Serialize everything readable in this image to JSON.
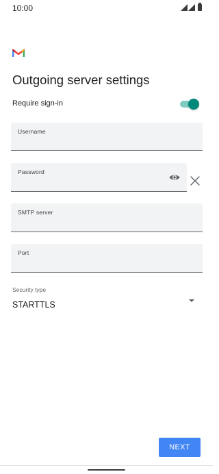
{
  "status_bar": {
    "time": "10:00"
  },
  "app": {
    "logo_icon": "gmail-logo-icon"
  },
  "page": {
    "title": "Outgoing server settings"
  },
  "require_sign_in": {
    "label": "Require sign-in",
    "enabled": true
  },
  "fields": {
    "username": {
      "label": "Username",
      "value": ""
    },
    "password": {
      "label": "Password",
      "value": ""
    },
    "smtp_server": {
      "label": "SMTP server",
      "value": ""
    },
    "port": {
      "label": "Port",
      "value": ""
    }
  },
  "security": {
    "label": "Security type",
    "value": "STARTTLS"
  },
  "buttons": {
    "next": "NEXT"
  },
  "colors": {
    "toggle_thumb": "#00897b",
    "toggle_track": "#80cbc4",
    "next_button": "#4285f4",
    "gmail_red": "#ea4335"
  }
}
